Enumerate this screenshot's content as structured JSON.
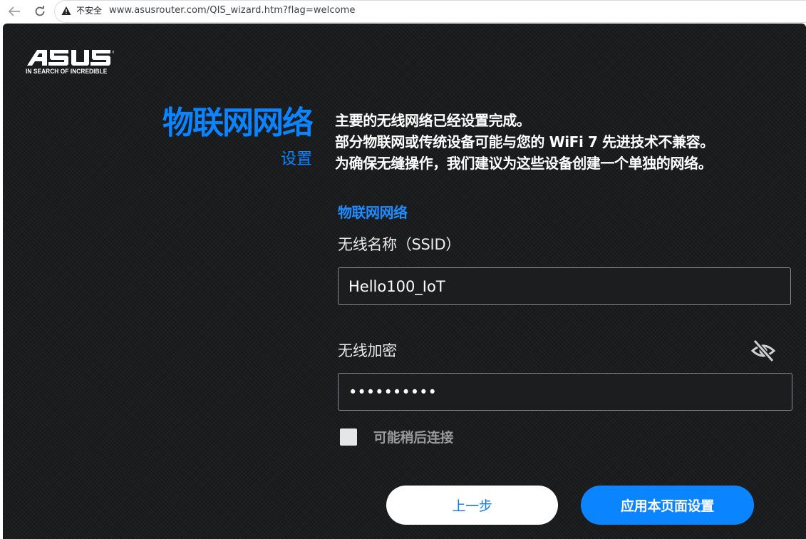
{
  "browser": {
    "security_label": "不安全",
    "url": "www.asusrouter.com/QIS_wizard.htm?flag=welcome",
    "icons": {
      "back": "arrow-left-icon",
      "reload": "reload-icon",
      "warning": "warning-triangle-icon"
    }
  },
  "brand": {
    "logo_text": "ASUS",
    "tagline": "IN SEARCH OF INCREDIBLE"
  },
  "header": {
    "title": "物联网网络",
    "subtitle": "设置"
  },
  "intro": {
    "lines": [
      "主要的无线网络已经设置完成。",
      "部分物联网或传统设备可能与您的 WiFi 7 先进技术不兼容。",
      "为确保无缝操作，我们建议为这些设备创建一个单独的网络。"
    ]
  },
  "form": {
    "section_title": "物联网网络",
    "ssid": {
      "label": "无线名称（SSID）",
      "value": "Hello100_IoT"
    },
    "password": {
      "label": "无线加密",
      "value": "••••••••••",
      "toggle_icon": "eye-slash-icon"
    },
    "later_checkbox": {
      "label": "可能稍后连接",
      "checked": false
    }
  },
  "buttons": {
    "back": "上一步",
    "apply": "应用本页面设置"
  },
  "colors": {
    "accent": "#0a84ff",
    "background": "#1b1c1e",
    "text": "#ffffff"
  }
}
